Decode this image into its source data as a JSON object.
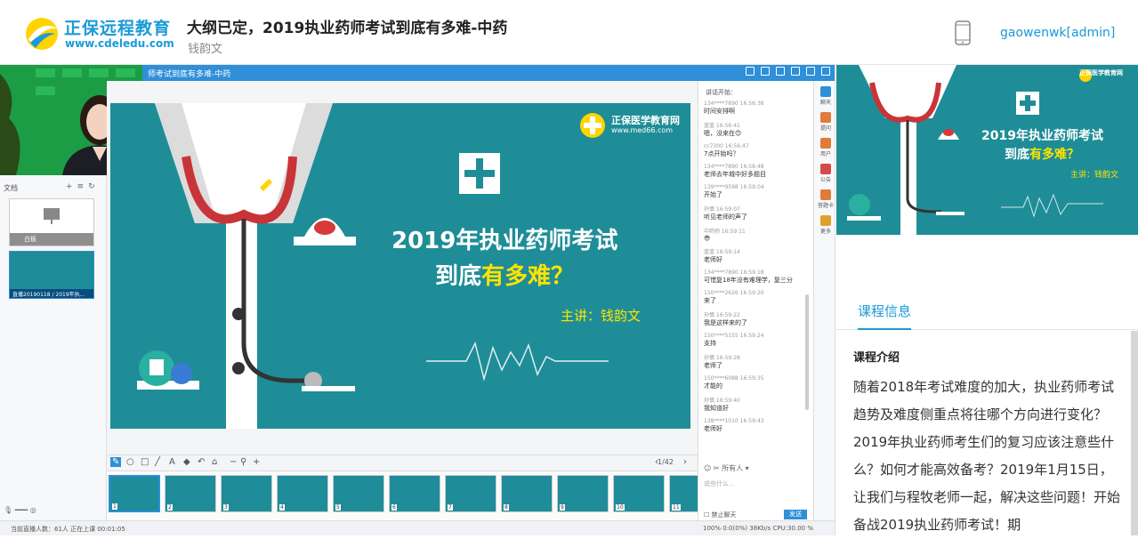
{
  "header": {
    "logo_cn": "正保远程教育",
    "logo_url": "www.cdeledu.com",
    "title": "大纲已定，2019执业药师考试到底有多难-中药",
    "teacher": "钱韵文",
    "user": "gaowenwk[admin]"
  },
  "player": {
    "window_title": "师考试到底有多难-中药",
    "docs_label": "文档",
    "thumb1_label": "白板",
    "thumb2_label": "直播20190118 / 2019年执...",
    "slide": {
      "logo_cn": "正保医学教育网",
      "logo_url": "www.med66.com",
      "title_line1": "2019年执业药师考试",
      "title_line2_pre": "到底",
      "title_line2_hl": "有多难？",
      "speaker": "主讲：钱韵文"
    },
    "page_indicator": "1/42",
    "filmstrip": [
      "1",
      "2",
      "3",
      "4",
      "5",
      "6",
      "7",
      "8",
      "9",
      "10",
      "11"
    ],
    "status_left": "当前直播人数：61人   正在上课  00:01:05",
    "status_right": "100%   0:0(0%)   38Kb/s   CPU:30.00 %"
  },
  "chat": {
    "header": "讲话开始：",
    "messages": [
      {
        "who": "134****7890 16:56:38",
        "txt": "时间安排啊"
      },
      {
        "who": "蓝蓝 16:56:41",
        "txt": "嗯，没来在😊"
      },
      {
        "who": "cc7300 16:56:47",
        "txt": "7点开始吗？"
      },
      {
        "who": "134****7890 16:58:48",
        "txt": "老师去年城中好多题目"
      },
      {
        "who": "139****9598 16:59:04",
        "txt": "开始了"
      },
      {
        "who": "孙慎 16:59:07",
        "txt": "听见老师的声了"
      },
      {
        "who": "中药师 16:59:11",
        "txt": "😎"
      },
      {
        "who": "蓝蓝 16:59:14",
        "txt": "老师好"
      },
      {
        "who": "134****7890 16:59:18",
        "txt": "可惜复18年没有难理学，复三分"
      },
      {
        "who": "150****2626 16:59:20",
        "txt": "来了"
      },
      {
        "who": "孙慎 16:59:22",
        "txt": "我是这样来的了"
      },
      {
        "who": "150****5155 16:59:24",
        "txt": "支持"
      },
      {
        "who": "孙慎 16:59:28",
        "txt": "老师了"
      },
      {
        "who": "150****6088 16:59:35",
        "txt": "才能的"
      },
      {
        "who": "孙慎 16:59:40",
        "txt": "我知道好"
      },
      {
        "who": "138****1010 16:59:43",
        "txt": "老师好"
      }
    ],
    "tools": "☺  ✂   所有人  ▾",
    "input_placeholder": "说些什么...",
    "block_label": "禁止聊天",
    "send_label": "发送"
  },
  "side_tabs": [
    "聊天",
    "提问",
    "用户",
    "公告",
    "答题卡",
    "更多"
  ],
  "right": {
    "logo": "正保医学教育网",
    "title_line1": "2019年执业药师考试",
    "title_line2_pre": "到底",
    "title_line2_hl": "有多难？",
    "speaker": "主讲：钱韵文",
    "tab_label": "课程信息",
    "intro_heading": "课程介绍",
    "intro_text": "随着2018年考试难度的加大，执业药师考试趋势及难度侧重点将往哪个方向进行变化？2019年执业药师考生们的复习应该注意些什么？如何才能高效备考？2019年1月15日，让我们与程牧老师一起，解决这些问题！开始备战2019执业药师考试！期"
  },
  "colors": {
    "brand": "#1a9ad8",
    "slide_bg": "#1e8d97",
    "highlight": "#ffe400"
  }
}
